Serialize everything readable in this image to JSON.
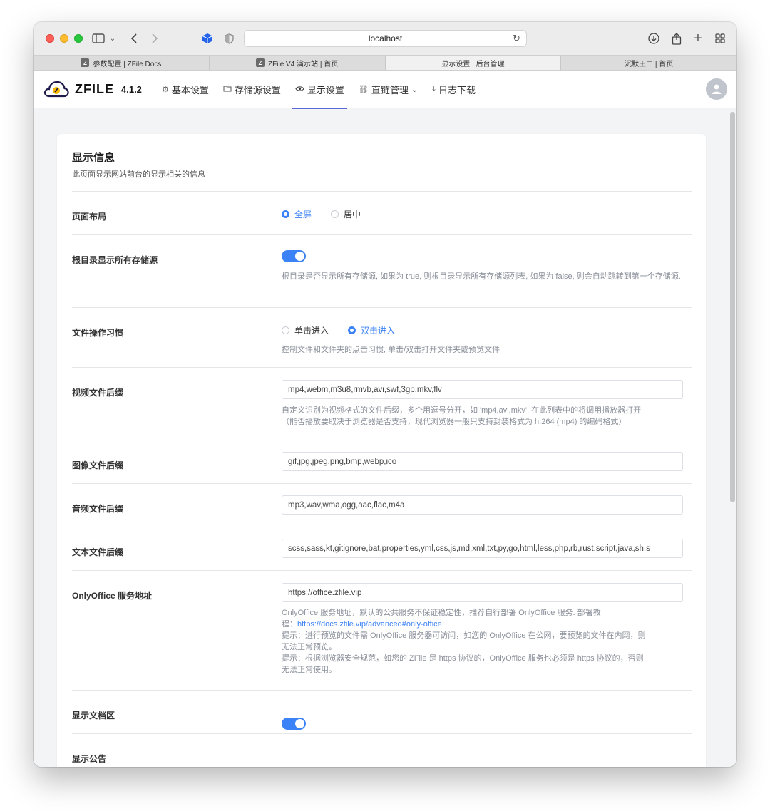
{
  "browser": {
    "url": "localhost",
    "tabs": [
      {
        "label": "参数配置 | ZFile Docs",
        "favicon": "Z"
      },
      {
        "label": "ZFile V4 演示站 | 首页",
        "favicon": "Z"
      },
      {
        "label": "显示设置 | 后台管理",
        "favicon": ""
      },
      {
        "label": "沉默王二 | 首页",
        "favicon": ""
      }
    ],
    "active_tab": 2
  },
  "app": {
    "logo_text": "ZFILE",
    "version": "4.1.2",
    "nav": [
      {
        "label": "基本设置",
        "icon": "gear-icon"
      },
      {
        "label": "存储源设置",
        "icon": "folder-icon"
      },
      {
        "label": "显示设置",
        "icon": "eye-icon"
      },
      {
        "label": "直链管理",
        "icon": "link-icon"
      },
      {
        "label": "日志下载",
        "icon": "download-icon"
      }
    ],
    "accent_color": "#3b82f6"
  },
  "page": {
    "title": "显示信息",
    "subtitle": "此页面显示网站前台的显示相关的信息",
    "layout": {
      "label": "页面布局",
      "options": [
        "全屏",
        "居中"
      ],
      "selected": "全屏"
    },
    "root_show_all": {
      "label": "根目录显示所有存储源",
      "enabled": true,
      "help": "根目录是否显示所有存储源, 如果为 true, 则根目录显示所有存储源列表, 如果为 false, 则会自动跳转到第一个存储源."
    },
    "file_habit": {
      "label": "文件操作习惯",
      "options": [
        "单击进入",
        "双击进入"
      ],
      "selected": "双击进入",
      "help": "控制文件和文件夹的点击习惯, 单击/双击打开文件夹或预览文件"
    },
    "video_suffix": {
      "label": "视频文件后缀",
      "value": "mp4,webm,m3u8,rmvb,avi,swf,3gp,mkv,flv",
      "help1": "自定义识别为视频格式的文件后缀，多个用逗号分开，如 'mp4,avi,mkv', 在此列表中的将调用播放器打开",
      "help2": "（能否播放要取决于浏览器是否支持，现代浏览器一般只支持封装格式为 h.264 (mp4) 的编码格式）"
    },
    "image_suffix": {
      "label": "图像文件后缀",
      "value": "gif,jpg,jpeg,png,bmp,webp,ico"
    },
    "audio_suffix": {
      "label": "音频文件后缀",
      "value": "mp3,wav,wma,ogg,aac,flac,m4a"
    },
    "text_suffix": {
      "label": "文本文件后缀",
      "value": "scss,sass,kt,gitignore,bat,properties,yml,css,js,md,xml,txt,py,go,html,less,php,rb,rust,script,java,sh,s"
    },
    "onlyoffice": {
      "label": "OnlyOffice 服务地址",
      "value": "https://office.zfile.vip",
      "help_line1": "OnlyOffice 服务地址，默认的公共服务不保证稳定性，推荐自行部署 OnlyOffice 服务. 部署教",
      "help_line2_prefix": "程：",
      "help_link": "https://docs.zfile.vip/advanced#only-office",
      "tip1_line1": "提示：进行预览的文件需 OnlyOffice 服务器可访问，如您的 OnlyOffice 在公网，要预览的文件在内网，则",
      "tip1_line2": "无法正常预览。",
      "tip2_line1": "提示：根据浏览器安全规范，如您的 ZFile 是 https 协议的，OnlyOffice 服务也必须是 https 协议的，否则",
      "tip2_line2": "无法正常使用。"
    },
    "show_docs": {
      "label": "显示文档区",
      "enabled": true
    },
    "show_announcement": {
      "label": "显示公告",
      "enabled": true
    }
  }
}
